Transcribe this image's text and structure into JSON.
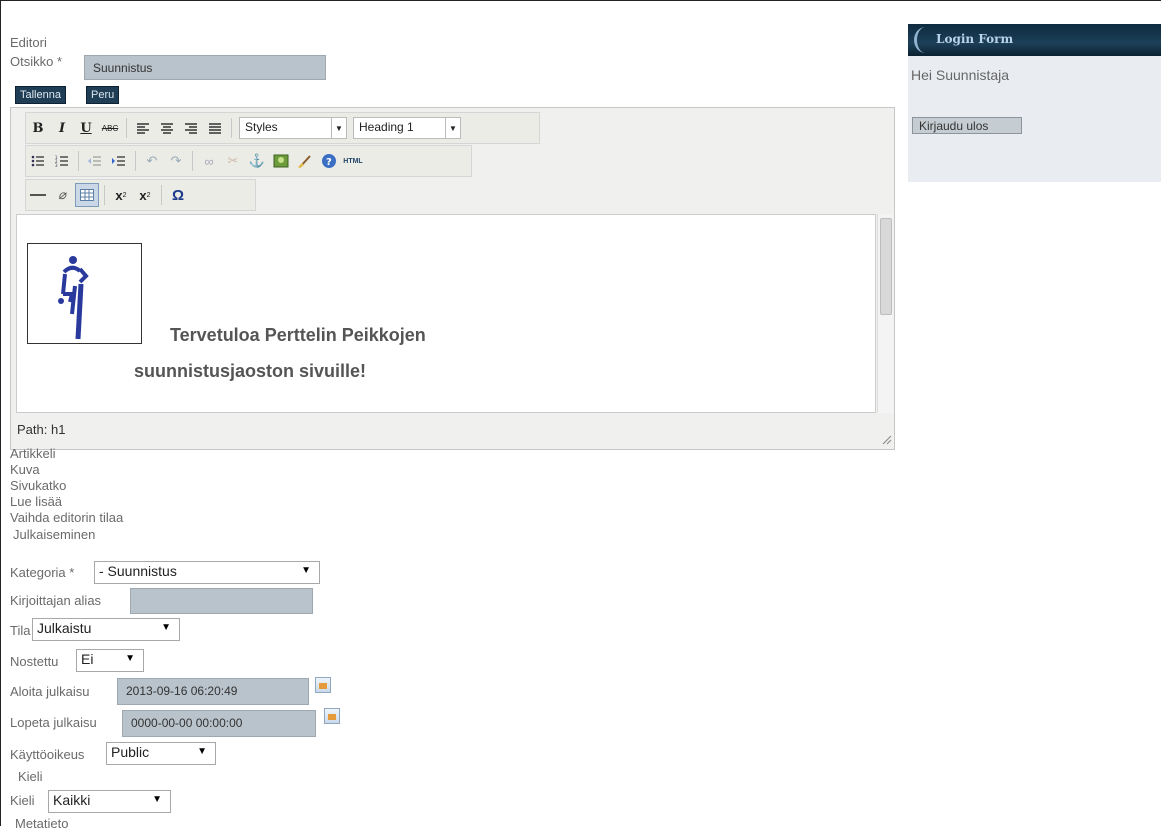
{
  "editor_title": "Editori",
  "title_field": {
    "label": "Otsikko *",
    "value": "Suunnistus"
  },
  "buttons": {
    "save": "Tallenna",
    "cancel": "Peru"
  },
  "toolbar": {
    "styles_select": "Styles",
    "format_select": "Heading 1",
    "row1_icons": [
      "bold-icon",
      "italic-icon",
      "underline-icon",
      "strikethrough-icon",
      "align-left-icon",
      "align-center-icon",
      "align-right-icon",
      "align-justify-icon"
    ],
    "row2_icons": [
      "bullet-list-icon",
      "numbered-list-icon",
      "outdent-icon",
      "indent-icon",
      "undo-icon",
      "redo-icon",
      "link-icon",
      "unlink-icon",
      "anchor-icon",
      "image-icon",
      "cleanup-icon",
      "help-icon",
      "html-icon"
    ],
    "row3_icons": [
      "horizontal-rule-icon",
      "eraser-icon",
      "table-icon",
      "subscript-icon",
      "superscript-icon",
      "omega-icon"
    ]
  },
  "content": {
    "heading_line1": "Tervetuloa Perttelin Peikkojen",
    "heading_line2": "suunnistusjaoston sivuille!"
  },
  "path_bar": "Path: h1",
  "links": [
    "Artikkeli",
    "Kuva",
    "Sivukatko",
    "Lue lisää",
    "Vaihda editorin tilaa"
  ],
  "publishing": {
    "section_title": "Julkaiseminen",
    "category": {
      "label": "Kategoria *",
      "value": "- Suunnistus"
    },
    "author_alias": {
      "label": "Kirjoittajan alias",
      "value": ""
    },
    "state": {
      "label": "Tila",
      "value": "Julkaistu"
    },
    "featured": {
      "label": "Nostettu",
      "value": "Ei"
    },
    "publish_up": {
      "label": "Aloita julkaisu",
      "value": "2013-09-16 06:20:49"
    },
    "publish_down": {
      "label": "Lopeta julkaisu",
      "value": "0000-00-00 00:00:00"
    },
    "access": {
      "label": "Käyttöoikeus",
      "value": "Public"
    }
  },
  "language": {
    "section_title": "Kieli",
    "label": "Kieli",
    "value": "Kaikki"
  },
  "metadata_title": "Metatieto",
  "login": {
    "title": "Login Form",
    "greeting": "Hei Suunnistaja",
    "logout": "Kirjaudu ulos"
  },
  "colors": {
    "accent_dark": "#1f3d55",
    "input_bg": "#b9c3cb",
    "panel_bg": "#e9edf1"
  }
}
